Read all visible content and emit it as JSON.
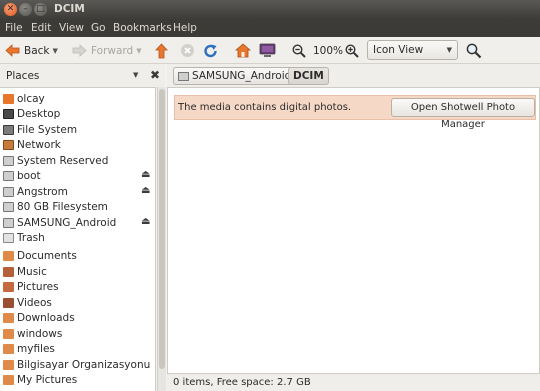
{
  "window": {
    "title": "DCIM"
  },
  "menu": [
    "File",
    "Edit",
    "View",
    "Go",
    "Bookmarks",
    "Help"
  ],
  "toolbar": {
    "back_label": "Back",
    "forward_label": "Forward",
    "zoom_level": "100%",
    "view_mode": "Icon View"
  },
  "sidebar": {
    "title": "Places",
    "groups": [
      [
        {
          "label": "olcay",
          "icon": "home-folder-icon"
        },
        {
          "label": "Desktop",
          "icon": "desktop-icon"
        },
        {
          "label": "File System",
          "icon": "filesystem-icon"
        },
        {
          "label": "Network",
          "icon": "network-icon"
        },
        {
          "label": "System Reserved",
          "icon": "drive-icon"
        },
        {
          "label": "boot",
          "icon": "drive-icon",
          "eject": true
        },
        {
          "label": "Angstrom",
          "icon": "drive-icon",
          "eject": true
        },
        {
          "label": "80 GB Filesystem",
          "icon": "drive-icon"
        },
        {
          "label": "SAMSUNG_Android",
          "icon": "drive-icon",
          "eject": true
        },
        {
          "label": "Trash",
          "icon": "trash-icon"
        }
      ],
      [
        {
          "label": "Documents",
          "icon": "folder-icon"
        },
        {
          "label": "Music",
          "icon": "music-folder-icon"
        },
        {
          "label": "Pictures",
          "icon": "pictures-folder-icon"
        },
        {
          "label": "Videos",
          "icon": "videos-folder-icon"
        },
        {
          "label": "Downloads",
          "icon": "downloads-folder-icon"
        },
        {
          "label": "windows",
          "icon": "folder-icon"
        },
        {
          "label": "myfiles",
          "icon": "folder-icon"
        },
        {
          "label": "Bilgisayar Organizasyonu",
          "icon": "folder-icon"
        },
        {
          "label": "My Pictures",
          "icon": "folder-icon"
        }
      ]
    ]
  },
  "pathbar": {
    "items": [
      "SAMSUNG_Android",
      "DCIM"
    ]
  },
  "infobar": {
    "message": "The media contains digital photos.",
    "button_label": "Open Shotwell Photo Manager"
  },
  "status": {
    "text": "0 items, Free space: 2.7 GB"
  },
  "colors": {
    "accent": "#f07746",
    "infobar_bg": "#f6d8c7",
    "menubar_bg": "#3c3b37"
  }
}
